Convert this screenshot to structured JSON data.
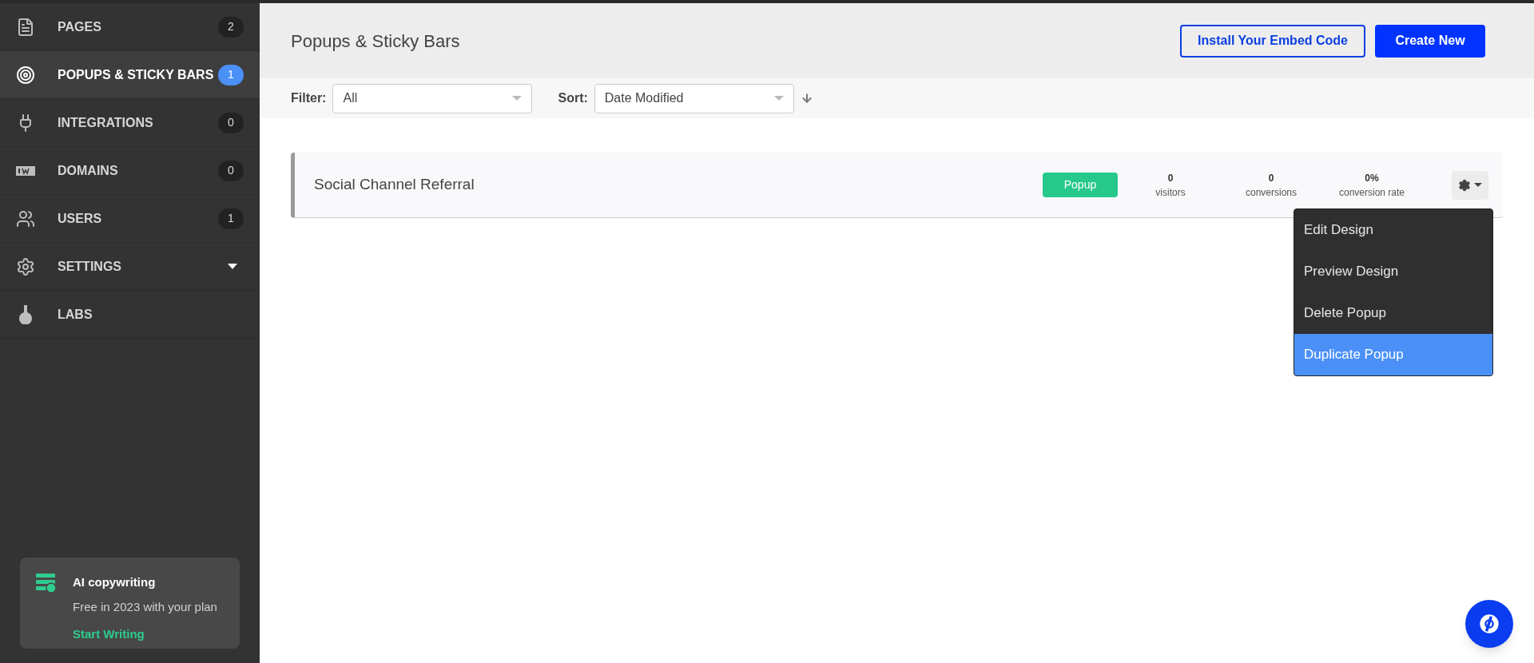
{
  "sidebar": {
    "items": [
      {
        "kind": "count",
        "label": "PAGES",
        "count": "2",
        "selected": false
      },
      {
        "kind": "count",
        "label": "POPUPS & STICKY BARS",
        "count": "1",
        "selected": true
      },
      {
        "kind": "count",
        "label": "INTEGRATIONS",
        "count": "0",
        "selected": false
      },
      {
        "kind": "count",
        "label": "DOMAINS",
        "count": "0",
        "selected": false
      },
      {
        "kind": "count",
        "label": "USERS",
        "count": "1",
        "selected": false
      },
      {
        "kind": "dropdown",
        "label": "SETTINGS",
        "selected": false
      },
      {
        "kind": "plain",
        "label": "LABS",
        "selected": false
      }
    ],
    "promo": {
      "title": "AI copywriting",
      "text": "Free in 2023 with your plan",
      "link": "Start Writing"
    }
  },
  "header": {
    "title": "Popups & Sticky Bars",
    "buttons": [
      {
        "kind": "outline",
        "label": "Install Your Embed Code"
      },
      {
        "kind": "primary",
        "label": "Create New"
      }
    ]
  },
  "toolbar": {
    "filter": {
      "label": "Filter:",
      "value": "All"
    },
    "sort": {
      "label": "Sort:",
      "value": "Date Modified"
    }
  },
  "rows": [
    {
      "name": "Social Channel Referral",
      "tag": "Popup",
      "stats": [
        {
          "value": "0",
          "label": "visitors"
        },
        {
          "value": "0",
          "label": "conversions"
        },
        {
          "value": "0%",
          "label": "conversion rate"
        }
      ],
      "menu": [
        {
          "label": "Edit Design",
          "selected": false
        },
        {
          "label": "Preview Design",
          "selected": false
        },
        {
          "label": "Delete Popup",
          "selected": false
        },
        {
          "label": "Duplicate Popup",
          "selected": true
        }
      ]
    }
  ]
}
